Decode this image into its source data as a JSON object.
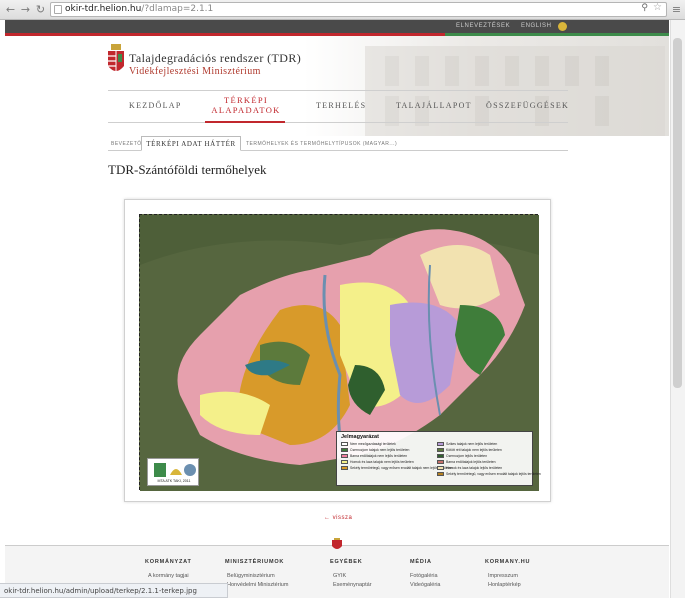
{
  "browser": {
    "url_host": "okir-tdr.helion.hu",
    "url_path": "/?dlamap=2.1.1",
    "status_url": "okir-tdr.helion.hu/admin/upload/terkep/2.1.1-terkep.jpg"
  },
  "topbar": {
    "links": [
      "ELNEVEZTÉSEK",
      "ENGLISH"
    ]
  },
  "header": {
    "title": "Talajdegradációs rendszer (TDR)",
    "subtitle": "Vidékfejlesztési Minisztérium"
  },
  "main_nav": [
    {
      "label": "KEZDŐLAP"
    },
    {
      "label": "TÉRKÉPI ALAPADATOK",
      "line1": "TÉRKÉPI",
      "line2": "ALAPADATOK"
    },
    {
      "label": "TERHELÉS"
    },
    {
      "label": "TALAJÁLLAPOT"
    },
    {
      "label": "ÖSSZEFÜGGÉSEK"
    }
  ],
  "sub_nav": [
    {
      "label": "BEVEZETŐ"
    },
    {
      "label": "TÉRKÉPI ADAT HÁTTÉR"
    },
    {
      "label": "TERMŐHELYEK ÉS TERMŐHELYTÍPUSOK (MAGYAR...)"
    }
  ],
  "page_title": "TDR-Szántóföldi termőhelyek",
  "map": {
    "legend_title": "Jelmagyarázat",
    "legend_items": [
      {
        "label": "Nem mezőgazdasági területek",
        "color": "#ffffff"
      },
      {
        "label": "Csernozjom talajok nem lejtős területen",
        "color": "#3f7d3a"
      },
      {
        "label": "Barna erdőtalajok nem lejtős területen",
        "color": "#f07fa0"
      },
      {
        "label": "Homok és laza talajok nem lejtős területen",
        "color": "#f4f08a"
      },
      {
        "label": "Sekély termőrétegű, vagy erősen erodált talajok nem lejtős területen",
        "color": "#d89a2a"
      },
      {
        "label": "Szikes talajok nem lejtős területen",
        "color": "#b79bd8"
      },
      {
        "label": "Kötött réti talajok nem lejtős területen",
        "color": "#5c7a3c"
      },
      {
        "label": "Csernozjom lejtős területen",
        "color": "#2f5f2e"
      },
      {
        "label": "Barna erdőtalajok lejtős területen",
        "color": "#c7706a"
      },
      {
        "label": "Homok és laza talajok lejtős területen",
        "color": "#f2e2b0"
      },
      {
        "label": "Sekély termőrétegű, vagy erősen erodált talajok lejtős területen",
        "color": "#b58020"
      }
    ],
    "logo_text": "MTA ATK TAKI, 2011"
  },
  "back_link": "← vissza",
  "footer": {
    "columns": [
      {
        "heading": "KORMÁNYZAT",
        "links": [
          "A kormány tagjai"
        ]
      },
      {
        "heading": "MINISZTÉRIUMOK",
        "links": [
          "Belügyminisztérium",
          "Honvédelmi Minisztérium"
        ]
      },
      {
        "heading": "EGYÉBEK",
        "links": [
          "GYIK",
          "Eseménynaptár"
        ]
      },
      {
        "heading": "MÉDIA",
        "links": [
          "Fotógaléria",
          "Videógaléria"
        ]
      },
      {
        "heading": "KORMANY.HU",
        "links": [
          "Impresszum",
          "Honlaptérkép"
        ]
      }
    ]
  },
  "colors": {
    "accent_red": "#c1272d",
    "accent_green": "#3d8b4a",
    "topbar_bg": "#4a4a4a"
  }
}
